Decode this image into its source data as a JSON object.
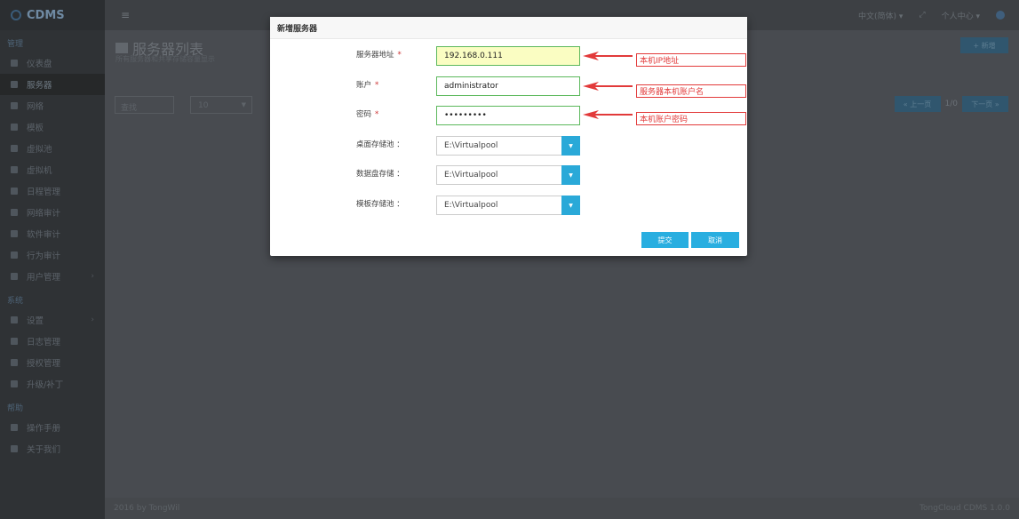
{
  "app": {
    "brand": "CDMS"
  },
  "sidebar": {
    "sections": [
      {
        "title": "管理"
      },
      {
        "title": "系统"
      },
      {
        "title": "帮助"
      }
    ],
    "items": [
      {
        "label": "仪表盘",
        "icon": "dashboard-icon"
      },
      {
        "label": "服务器",
        "icon": "server-icon"
      },
      {
        "label": "网络",
        "icon": "network-icon"
      },
      {
        "label": "模板",
        "icon": "template-icon"
      },
      {
        "label": "虚拟池",
        "icon": "pool-icon"
      },
      {
        "label": "虚拟机",
        "icon": "monitor-icon"
      },
      {
        "label": "日程管理",
        "icon": "calendar-icon"
      },
      {
        "label": "网络审计",
        "icon": "audit-icon"
      },
      {
        "label": "软件审计",
        "icon": "software-icon"
      },
      {
        "label": "行为审计",
        "icon": "behavior-icon"
      },
      {
        "label": "用户管理",
        "icon": "user-icon"
      },
      {
        "label": "设置",
        "icon": "gear-icon"
      },
      {
        "label": "日志管理",
        "icon": "log-icon"
      },
      {
        "label": "授权管理",
        "icon": "key-icon"
      },
      {
        "label": "升级/补丁",
        "icon": "cloud-upload-icon"
      },
      {
        "label": "操作手册",
        "icon": "help-icon"
      },
      {
        "label": "关于我们",
        "icon": "info-icon"
      }
    ]
  },
  "topbar": {
    "language": "中文(简体) ▾",
    "user_menu": "个人中心 ▾"
  },
  "page": {
    "title": "服务器列表",
    "subtitle": "所有服务器和共享存储容量显示",
    "new_button": "+ 新增",
    "search_placeholder": "查找",
    "page_size": "10",
    "prev_button": "« 上一页",
    "next_button": "下一页 »",
    "page_info": "1/0"
  },
  "footer": {
    "left": "2016 by TongWil",
    "right": "TongCloud CDMS 1.0.0"
  },
  "modal": {
    "title": "新增服务器",
    "fields": {
      "address_label": "服务器地址",
      "address_value": "192.168.0.111",
      "account_label": "账户",
      "account_value": "administrator",
      "password_label": "密码",
      "password_value": "•••••••••",
      "desktop_pool_label": "桌面存储池 ：",
      "desktop_pool_value": "E:\\Virtualpool",
      "data_disk_label": "数据盘存储 ：",
      "data_disk_value": "E:\\Virtualpool",
      "template_label": "模板存储池 ：",
      "template_value": "E:\\Virtualpool"
    },
    "required_mark": "*",
    "submit_button": "提交",
    "cancel_button": "取消"
  },
  "annotations": {
    "ip": "本机IP地址",
    "account": "服务器本机账户名",
    "password": "本机账户密码",
    "color": "#e23a3a"
  }
}
